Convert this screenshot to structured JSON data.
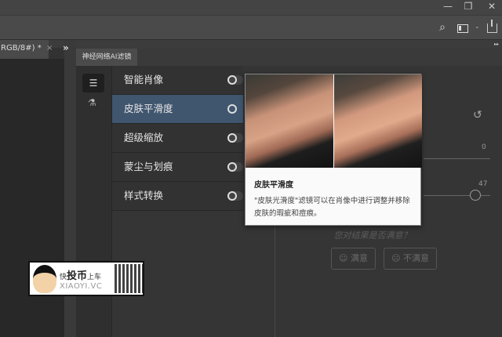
{
  "window": {
    "minimize_icon": "minimize-icon",
    "restore_icon": "restore-icon",
    "close_icon": "close-icon"
  },
  "toolbar": {
    "search_icon": "search-icon",
    "workspace_icon": "workspace-icon",
    "share_icon": "share-icon"
  },
  "document_tab": {
    "label": "RGB/8#) *",
    "close": "×"
  },
  "collapse": "»",
  "panel": {
    "tab_label": "神经网络AI滤镜",
    "filters": [
      {
        "label": "智能肖像",
        "enabled": false,
        "selected": false
      },
      {
        "label": "皮肤平滑度",
        "enabled": false,
        "selected": true
      },
      {
        "label": "超级缩放",
        "enabled": false,
        "selected": false
      },
      {
        "label": "蒙尘与划痕",
        "enabled": false,
        "selected": false
      },
      {
        "label": "样式转换",
        "enabled": false,
        "selected": false
      }
    ],
    "tooltip": {
      "title": "皮肤平滑度",
      "description": "\"皮肤光滑度\"滤镜可以在肖像中进行调整并移除皮肤的瑕疵和痘痕。"
    },
    "sliders": [
      {
        "value": "0"
      },
      {
        "value": "47"
      }
    ],
    "feedback": {
      "question": "您对结果是否满意？",
      "satisfied": "满意",
      "unsatisfied": "不满意"
    }
  },
  "watermark": {
    "text1": "快",
    "text2": "投币",
    "text3": "上车",
    "domain": "XIAOYI.VC"
  },
  "colors": {
    "selected": "#40566f",
    "panel": "#353535"
  }
}
